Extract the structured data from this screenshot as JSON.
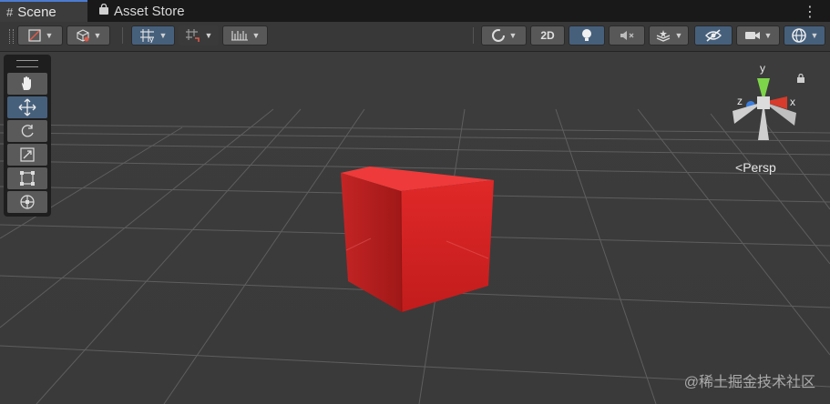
{
  "tabs": [
    {
      "label": "Scene",
      "icon": "grid-icon"
    },
    {
      "label": "Asset Store",
      "icon": "shopping-bag-icon"
    }
  ],
  "toolbar": {
    "two_d_label": "2D"
  },
  "scene": {
    "view_mode": "Persp",
    "axis_labels": {
      "x": "x",
      "y": "y",
      "z": "z"
    },
    "cube_color": "#d42020",
    "background": "#3a3a3a"
  },
  "watermark": "@稀土掘金技术社区",
  "colors": {
    "accent_tab": "#4c7bd1",
    "active_button": "#46607c",
    "axis_x": "#d63b2b",
    "axis_y": "#7dd54a",
    "axis_z": "#3b7fe0"
  }
}
